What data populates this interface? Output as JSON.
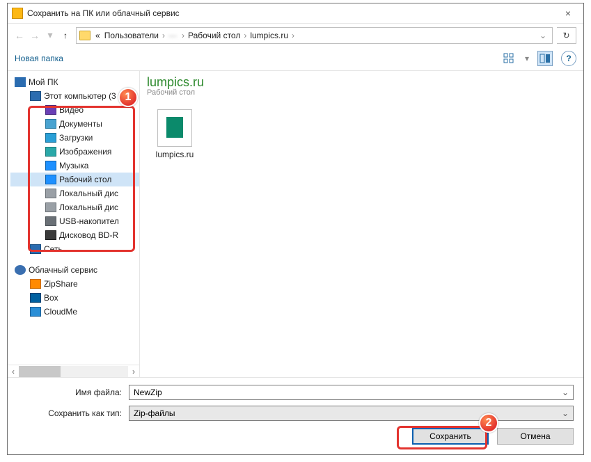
{
  "window": {
    "title": "Сохранить на ПК или облачный сервис"
  },
  "breadcrumb": {
    "prefix": "«",
    "p1": "Пользователи",
    "p2_blur": "—",
    "p3": "Рабочий стол",
    "p4": "lumpics.ru"
  },
  "toolbar": {
    "new_folder": "Новая папка"
  },
  "tree": {
    "my_pc": "Мой ПК",
    "this_pc": "Этот компьютер (3",
    "video": "Видео",
    "documents": "Документы",
    "downloads": "Загрузки",
    "images": "Изображения",
    "music": "Музыка",
    "desktop": "Рабочий стол",
    "local1": "Локальный дис",
    "local2": "Локальный дис",
    "usb": "USB-накопител",
    "bd": "Дисковод BD-R",
    "network": "Сеть",
    "cloud": "Облачный сервис",
    "zipshare": "ZipShare",
    "box": "Box",
    "cloudme": "CloudMe"
  },
  "location": {
    "title": "lumpics.ru",
    "subtitle": "Рабочий стол"
  },
  "file": {
    "name": "lumpics.ru"
  },
  "labels": {
    "filename": "Имя файла:",
    "filetype": "Сохранить как тип:"
  },
  "values": {
    "filename": "NewZip",
    "filetype": "Zip-файлы"
  },
  "buttons": {
    "save": "Сохранить",
    "cancel": "Отмена"
  },
  "annotations": {
    "b1": "1",
    "b2": "2"
  }
}
